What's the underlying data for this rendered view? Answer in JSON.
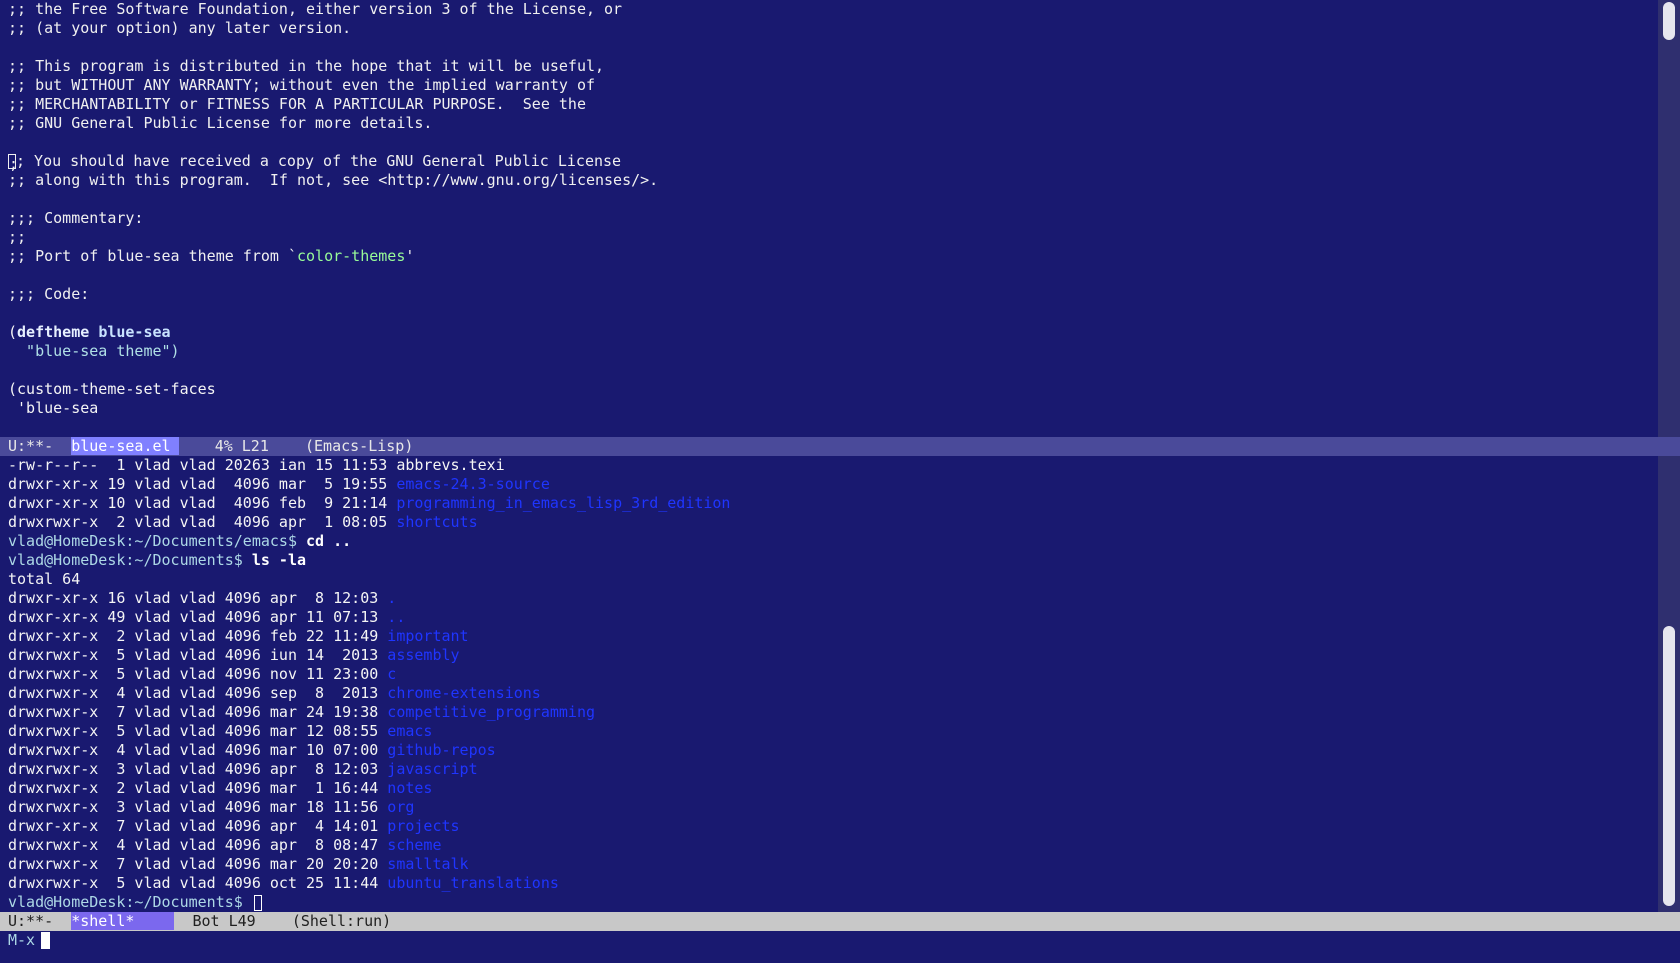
{
  "code_buffer": {
    "lines": [
      ";; the Free Software Foundation, either version 3 of the License, or",
      ";; (at your option) any later version.",
      "",
      ";; This program is distributed in the hope that it will be useful,",
      ";; but WITHOUT ANY WARRANTY; without even the implied warranty of",
      ";; MERCHANTABILITY or FITNESS FOR A PARTICULAR PURPOSE.  See the",
      ";; GNU General Public License for more details.",
      "",
      "; You should have received a copy of the GNU General Public License",
      ";; along with this program.  If not, see <http://www.gnu.org/licenses/>.",
      "",
      ";;; Commentary:",
      ";;",
      ";; Port of blue-sea theme from `",
      "",
      ";;; Code:",
      "",
      "(",
      "  \"blue-sea theme\")",
      "",
      "(custom-theme-set-faces",
      " 'blue-sea"
    ],
    "cursor_char": ";",
    "quote_text": "color-themes",
    "quote_close": "'",
    "deftheme_kw": "deftheme",
    "deftheme_name": "blue-sea"
  },
  "modeline_top": {
    "state": "U:**-",
    "buffer": "blue-sea.el",
    "position": "4% L21",
    "mode": "(Emacs-Lisp)"
  },
  "shell_buffer": {
    "pre_lines": [
      {
        "meta": "-rw-r--r--  1 vlad vlad 20263 ian 15 11:53 ",
        "name": "abbrevs.texi",
        "is_dir": false
      },
      {
        "meta": "drwxr-xr-x 19 vlad vlad  4096 mar  5 19:55 ",
        "name": "emacs-24.3-source",
        "is_dir": true
      },
      {
        "meta": "drwxr-xr-x 10 vlad vlad  4096 feb  9 21:14 ",
        "name": "programming_in_emacs_lisp_3rd_edition",
        "is_dir": true
      },
      {
        "meta": "drwxrwxr-x  2 vlad vlad  4096 apr  1 08:05 ",
        "name": "shortcuts",
        "is_dir": true
      }
    ],
    "cmd1": {
      "prompt": "vlad@HomeDesk:~/Documents/emacs$ ",
      "command": "cd .."
    },
    "cmd2": {
      "prompt": "vlad@HomeDesk:~/Documents$ ",
      "command": "ls -la"
    },
    "total": "total 64",
    "listing": [
      {
        "meta": "drwxr-xr-x 16 vlad vlad 4096 apr  8 12:03 ",
        "name": "."
      },
      {
        "meta": "drwxr-xr-x 49 vlad vlad 4096 apr 11 07:13 ",
        "name": ".."
      },
      {
        "meta": "drwxr-xr-x  2 vlad vlad 4096 feb 22 11:49 ",
        "name": "important"
      },
      {
        "meta": "drwxrwxr-x  5 vlad vlad 4096 iun 14  2013 ",
        "name": "assembly"
      },
      {
        "meta": "drwxrwxr-x  5 vlad vlad 4096 nov 11 23:00 ",
        "name": "c"
      },
      {
        "meta": "drwxrwxr-x  4 vlad vlad 4096 sep  8  2013 ",
        "name": "chrome-extensions"
      },
      {
        "meta": "drwxrwxr-x  7 vlad vlad 4096 mar 24 19:38 ",
        "name": "competitive_programming"
      },
      {
        "meta": "drwxrwxr-x  5 vlad vlad 4096 mar 12 08:55 ",
        "name": "emacs"
      },
      {
        "meta": "drwxrwxr-x  4 vlad vlad 4096 mar 10 07:00 ",
        "name": "github-repos"
      },
      {
        "meta": "drwxrwxr-x  3 vlad vlad 4096 apr  8 12:03 ",
        "name": "javascript"
      },
      {
        "meta": "drwxrwxr-x  2 vlad vlad 4096 mar  1 16:44 ",
        "name": "notes"
      },
      {
        "meta": "drwxrwxr-x  3 vlad vlad 4096 mar 18 11:56 ",
        "name": "org"
      },
      {
        "meta": "drwxr-xr-x  7 vlad vlad 4096 apr  4 14:01 ",
        "name": "projects"
      },
      {
        "meta": "drwxrwxr-x  4 vlad vlad 4096 apr  8 08:47 ",
        "name": "scheme"
      },
      {
        "meta": "drwxrwxr-x  7 vlad vlad 4096 mar 20 20:20 ",
        "name": "smalltalk"
      },
      {
        "meta": "drwxrwxr-x  5 vlad vlad 4096 oct 25 11:44 ",
        "name": "ubuntu_translations"
      }
    ],
    "final_prompt": "vlad@HomeDesk:~/Documents$ "
  },
  "modeline_bottom": {
    "state": "U:**-",
    "buffer": "*shell*",
    "position": "Bot L49",
    "mode": "(Shell:run)"
  },
  "minibuffer": {
    "text": "M-x"
  },
  "colors": {
    "background": "#191970",
    "directory": "#1f35ff",
    "prompt": "#add8e6"
  }
}
